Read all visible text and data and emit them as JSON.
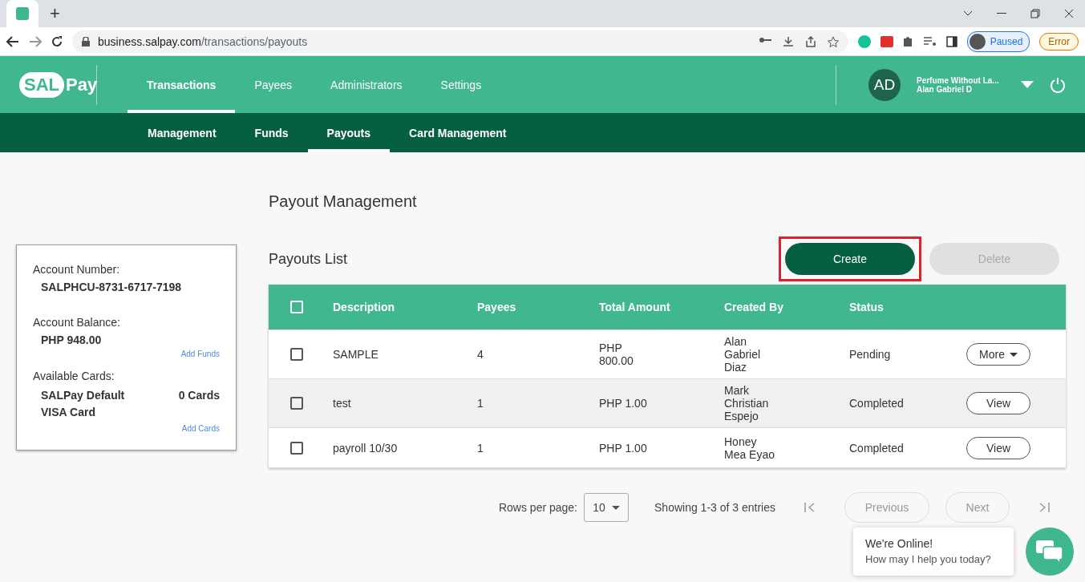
{
  "browser": {
    "new_tab": "+",
    "url_host": "business.salpay.com",
    "url_path": "/transactions/payouts",
    "profile": "Paused",
    "error": "Error"
  },
  "header": {
    "logo": [
      "SAL",
      "Pay"
    ],
    "nav": [
      {
        "label": "Transactions",
        "selected": true
      },
      {
        "label": "Payees",
        "selected": false
      },
      {
        "label": "Administrators",
        "selected": false
      },
      {
        "label": "Settings",
        "selected": false
      }
    ],
    "user": {
      "initials": "AD",
      "company": "Perfume Without La...",
      "name": "Alan Gabriel D"
    }
  },
  "subnav": [
    {
      "label": "Management",
      "selected": false
    },
    {
      "label": "Funds",
      "selected": false
    },
    {
      "label": "Payouts",
      "selected": true
    },
    {
      "label": "Card Management",
      "selected": false
    }
  ],
  "account": {
    "number_label": "Account Number:",
    "number": "SALPHCU-8731-6717-7198",
    "balance_label": "Account Balance:",
    "balance": "PHP 948.00",
    "add_funds": "Add Funds",
    "cards_label": "Available Cards:",
    "card_name": "SALPay Default VISA Card",
    "card_count": "0 Cards",
    "add_cards": "Add Cards"
  },
  "title": "Payout Management",
  "list_title": "Payouts List",
  "actions": [
    {
      "label": "Create",
      "disabled": false,
      "outlined": true
    },
    {
      "label": "Delete",
      "disabled": true,
      "outlined": false
    }
  ],
  "table": {
    "header_checked": false,
    "columns": [
      "Description",
      "Payees",
      "Total Amount",
      "Created By",
      "Status"
    ],
    "rows": [
      {
        "checked": false,
        "hovered": false,
        "cells": [
          "SAMPLE",
          "4",
          "PHP 800.00",
          "Alan Gabriel Diaz",
          "Pending"
        ],
        "action": {
          "label": "More",
          "kind": "menu"
        }
      },
      {
        "checked": false,
        "hovered": true,
        "cells": [
          "test",
          "1",
          "PHP 1.00",
          "Mark Christian Espejo",
          "Completed"
        ],
        "action": {
          "label": "View",
          "kind": "button"
        }
      },
      {
        "checked": false,
        "hovered": false,
        "cells": [
          "payroll 10/30",
          "1",
          "PHP 1.00",
          "Honey Mea Eyao",
          "Completed"
        ],
        "action": {
          "label": "View",
          "kind": "button"
        }
      }
    ]
  },
  "pagination": {
    "rows_label": "Rows per page:",
    "rows_value": "10",
    "summary": "Showing 1-3 of 3 entries",
    "previous": "Previous",
    "next": "Next"
  },
  "chat": {
    "title": "We're Online!",
    "subtitle": "How may I help you today?"
  }
}
